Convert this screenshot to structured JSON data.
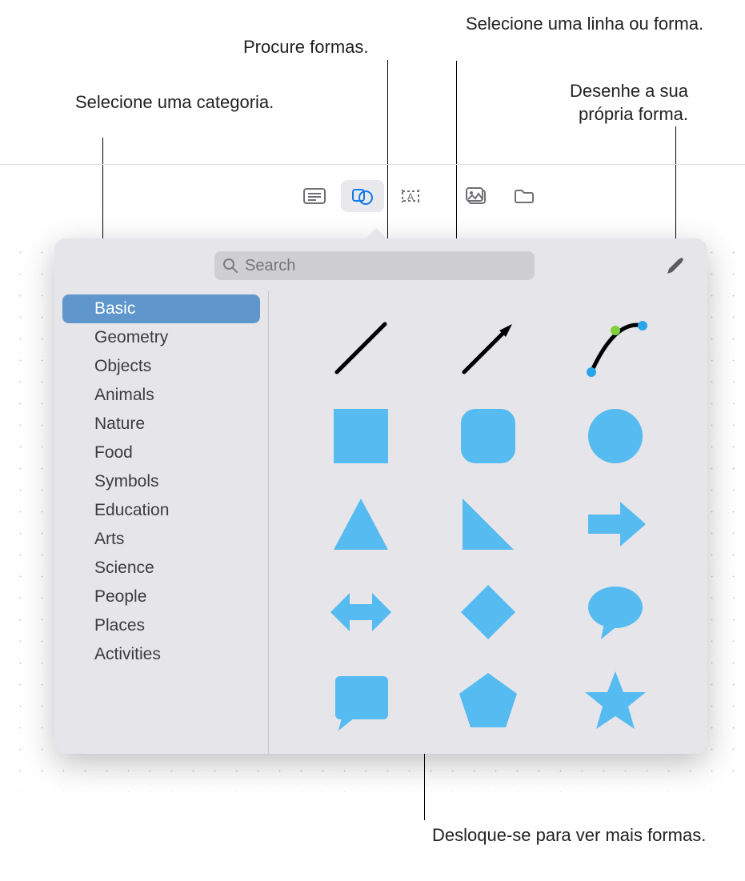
{
  "callouts": {
    "category": "Selecione uma categoria.",
    "search": "Procure formas.",
    "pick": "Selecione uma linha ou forma.",
    "draw": "Desenhe a sua própria forma.",
    "scroll": "Desloque-se para ver mais formas."
  },
  "search": {
    "placeholder": "Search"
  },
  "categories": [
    "Basic",
    "Geometry",
    "Objects",
    "Animals",
    "Nature",
    "Food",
    "Symbols",
    "Education",
    "Arts",
    "Science",
    "People",
    "Places",
    "Activities"
  ],
  "selected_category_index": 0,
  "shapes": [
    "line",
    "arrow-line",
    "curve-line",
    "square",
    "rounded-square",
    "circle",
    "triangle",
    "right-triangle",
    "arrow-right",
    "double-arrow",
    "diamond",
    "speech-bubble",
    "callout-rect",
    "pentagon",
    "star"
  ]
}
